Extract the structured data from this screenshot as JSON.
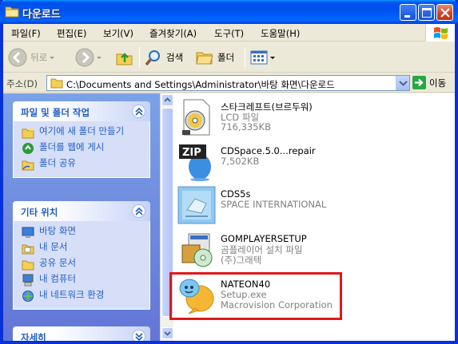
{
  "window": {
    "title": "다운로드",
    "colors": {
      "titlebar": "#0054e3",
      "highlight_box": "#e01818",
      "task_link": "#215dc6"
    }
  },
  "menu": {
    "items": [
      "파일(F)",
      "편집(E)",
      "보기(V)",
      "즐겨찾기(A)",
      "도구(T)",
      "도움말(H)"
    ]
  },
  "toolbar": {
    "back_label": "뒤로",
    "search_label": "검색",
    "folders_label": "폴더"
  },
  "address": {
    "label": "주소(D)",
    "path": "C:\\Documents and Settings\\Administrator\\바탕 화면\\다운로드",
    "go_label": "이동"
  },
  "left_panel": {
    "file_tasks": {
      "title": "파일 및 폴더 작업",
      "items": [
        {
          "label": "여기에 새 폴더 만들기",
          "icon": "new-folder-icon"
        },
        {
          "label": "폴더를 웹에 게시",
          "icon": "publish-web-icon"
        },
        {
          "label": "폴더 공유",
          "icon": "share-folder-icon"
        }
      ]
    },
    "other_places": {
      "title": "기타 위치",
      "items": [
        {
          "label": "바탕 화면",
          "icon": "desktop-icon"
        },
        {
          "label": "내 문서",
          "icon": "my-documents-icon"
        },
        {
          "label": "공유 문서",
          "icon": "shared-documents-icon"
        },
        {
          "label": "내 컴퓨터",
          "icon": "my-computer-icon"
        },
        {
          "label": "내 네트워크 환경",
          "icon": "network-icon"
        }
      ]
    },
    "details": {
      "title": "자세히"
    }
  },
  "files": [
    {
      "name": "스타크레프트(브르두워)",
      "line1": "LCD 파일",
      "line2": "716,335KB",
      "icon": "cd-image-icon"
    },
    {
      "name": "CDSpace.5.0...repair",
      "line1": "7,502KB",
      "line2": "",
      "icon": "zip-archive-icon"
    },
    {
      "name": "CDS5s",
      "line1": "SPACE INTERNATIONAL",
      "line2": "",
      "icon": "cdspace-installer-icon"
    },
    {
      "name": "GOMPLAYERSETUP",
      "line1": "곰플레이어 설치 파일",
      "line2": "(주)그래텍",
      "icon": "gomplayer-setup-icon"
    },
    {
      "name": "NATEON40",
      "line1": "Setup.exe",
      "line2": "Macrovision Corporation",
      "icon": "nateon-icon"
    }
  ]
}
